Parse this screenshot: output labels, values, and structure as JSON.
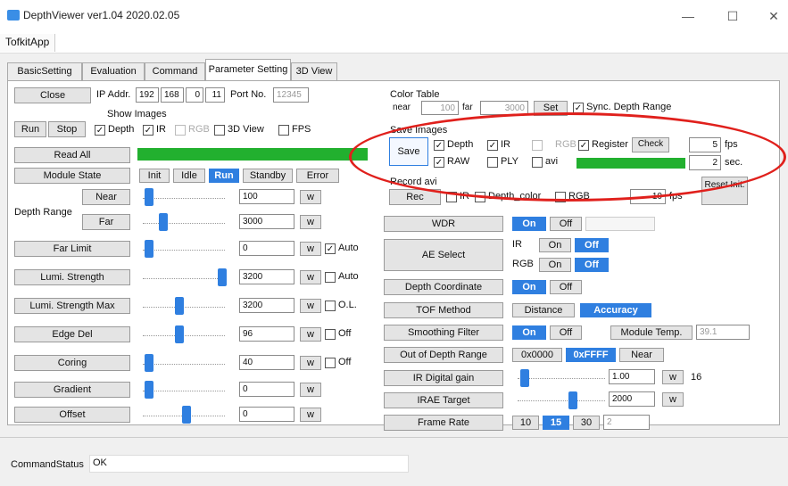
{
  "window": {
    "title": "DepthViewer ver1.04 2020.02.05",
    "minimize": "—",
    "maximize": "☐",
    "close": "✕"
  },
  "menu": {
    "item": "TofkitApp"
  },
  "tabs": [
    "BasicSetting",
    "Evaluation",
    "Command",
    "Parameter Setting",
    "3D View"
  ],
  "left": {
    "close_label": "Close",
    "ip_label": "IP Addr.",
    "ip": [
      "192",
      "168",
      "0",
      "11"
    ],
    "port_label": "Port No.",
    "port": "12345",
    "run_label": "Run",
    "stop_label": "Stop",
    "show_images_label": "Show Images",
    "show": [
      {
        "label": "Depth",
        "checked": true
      },
      {
        "label": "IR",
        "checked": true
      },
      {
        "label": "RGB",
        "checked": false
      },
      {
        "label": "3D View",
        "checked": false
      },
      {
        "label": "FPS",
        "checked": false
      }
    ],
    "read_all_label": "Read All",
    "module_state_label": "Module State",
    "states": [
      "Init",
      "Idle",
      "Run",
      "Standby",
      "Error"
    ],
    "active_state": "Run",
    "depth_range_label": "Depth Range",
    "near_label": "Near",
    "far_label": "Far",
    "w": "w",
    "rows": [
      {
        "label": "Near",
        "value": "100"
      },
      {
        "label": "Far",
        "value": "3000"
      },
      {
        "label": "Far Limit",
        "value": "0",
        "check": "Auto",
        "checked": true
      },
      {
        "label": "Lumi. Strength",
        "value": "3200",
        "check": "Auto",
        "checked": false
      },
      {
        "label": "Lumi. Strength Max",
        "value": "3200",
        "check": "O.L.",
        "checked": false
      },
      {
        "label": "Edge Del",
        "value": "96",
        "check": "Off",
        "checked": false
      },
      {
        "label": "Coring",
        "value": "40",
        "check": "Off",
        "checked": false
      },
      {
        "label": "Gradient",
        "value": "0"
      },
      {
        "label": "Offset",
        "value": "0"
      }
    ]
  },
  "right": {
    "color_table_label": "Color Table",
    "near_label": "near",
    "near_value": "100",
    "far_label": "far",
    "far_value": "3000",
    "set_label": "Set",
    "sync_label": "Sync. Depth Range",
    "save_images_label": "Save Images",
    "save_label": "Save",
    "save_opts": [
      {
        "label": "Depth",
        "checked": true
      },
      {
        "label": "IR",
        "checked": true
      },
      {
        "label": "RGB",
        "checked": false
      },
      {
        "label": "Register",
        "checked": true
      },
      {
        "label": "RAW",
        "checked": true
      },
      {
        "label": "PLY",
        "checked": false
      },
      {
        "label": "avi",
        "checked": false
      }
    ],
    "check_label": "Check",
    "fps_value": "5",
    "fps_label": "fps",
    "sec_value": "2",
    "sec_label": "sec.",
    "record_avi_label": "Record avi",
    "rec_label": "Rec",
    "rec_opts": [
      "IR",
      "Depth_color",
      "RGB"
    ],
    "rec_fps_value": "10",
    "rec_fps_label": "fps",
    "reset_init_label": "Reset Init.",
    "wdr_label": "WDR",
    "on": "On",
    "off": "Off",
    "ae_select_label": "AE Select",
    "ir_label": "IR",
    "rgb_label": "RGB",
    "depth_coord_label": "Depth Coordinate",
    "tof_method_label": "TOF Method",
    "distance_label": "Distance",
    "accuracy_label": "Accuracy",
    "smoothing_label": "Smoothing Filter",
    "module_temp_label": "Module Temp.",
    "module_temp_value": "39.1",
    "out_of_range_label": "Out of Depth Range",
    "oor_values": [
      "0x0000",
      "0xFFFF",
      "Near"
    ],
    "ir_gain_label": "IR Digital gain",
    "ir_gain_value": "1.00",
    "ir_gain_extra": "16",
    "irae_label": "IRAE Target",
    "irae_value": "2000",
    "frame_rate_label": "Frame Rate",
    "frame_rates": [
      "10",
      "15",
      "30"
    ],
    "frame_rate_selected": "15",
    "frame_rate_extra": "2",
    "w": "w"
  },
  "status": {
    "label": "CommandStatus",
    "value": "OK"
  },
  "colors": {
    "accent": "#2f7fe0",
    "progress": "#22b02f",
    "annotation": "#e0201c"
  }
}
